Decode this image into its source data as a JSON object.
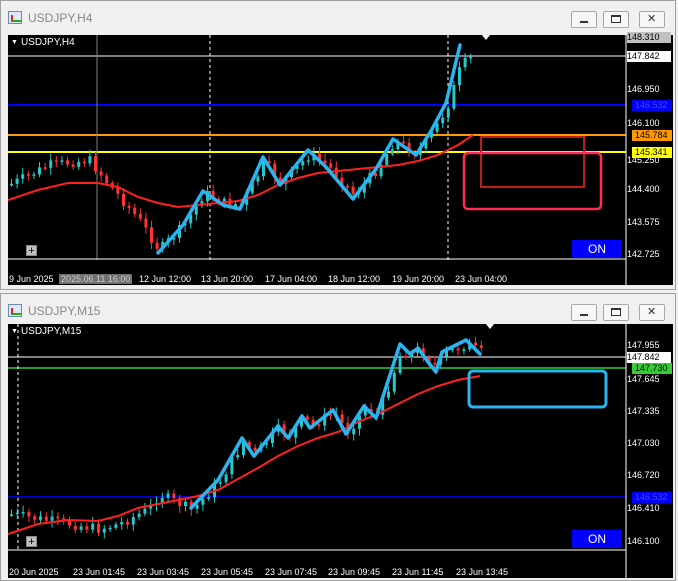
{
  "windows": [
    {
      "title": "USDJPY,H4",
      "symbol_label": "USDJPY,H4",
      "on_label": "ON",
      "price_labels": [
        "148.310",
        "147.842",
        "146.950",
        "146.100",
        "145.250",
        "144.400",
        "143.575",
        "142.725"
      ],
      "badges": [
        {
          "text": "146.532",
          "color": "#0000ff",
          "fg": "#4a4aff"
        },
        {
          "text": "145.784",
          "color": "#ff9900",
          "fg": "#000000"
        },
        {
          "text": "145.341",
          "color": "#ffff00",
          "fg": "#000000"
        }
      ],
      "time_labels": [
        "9 Jun 2025",
        "2025.06.11 16:00",
        "12 Jun 12:00",
        "13 Jun 20:00",
        "17 Jun 04:00",
        "18 Jun 12:00",
        "19 Jun 20:00",
        "23 Jun 04:00"
      ],
      "colors": {
        "ma": "#ff2020",
        "bull": "#27c8c8",
        "bear": "#ff3333",
        "drawn": "#2ab4f0",
        "rect": "#ff2a55",
        "rect2": "#c01a1a"
      }
    },
    {
      "title": "USDJPY,M15",
      "symbol_label": "USDJPY,M15",
      "on_label": "ON",
      "price_labels": [
        "147.955",
        "147.842",
        "147.645",
        "147.335",
        "147.030",
        "146.720",
        "146.410",
        "146.100"
      ],
      "badges": [
        {
          "text": "147.730",
          "color": "#33cc33",
          "fg": "#000000"
        },
        {
          "text": "146.532",
          "color": "#0000ff",
          "fg": "#4a4aff"
        }
      ],
      "time_labels": [
        "20 Jun 2025",
        "23 Jun 01:45",
        "23 Jun 03:45",
        "23 Jun 05:45",
        "23 Jun 07:45",
        "23 Jun 09:45",
        "23 Jun 11:45",
        "23 Jun 13:45"
      ],
      "colors": {
        "ma": "#ff2020",
        "bull": "#27c8c8",
        "bear": "#ff3333",
        "drawn": "#2ab4f0",
        "rect": "#2ab4f0"
      }
    }
  ]
}
